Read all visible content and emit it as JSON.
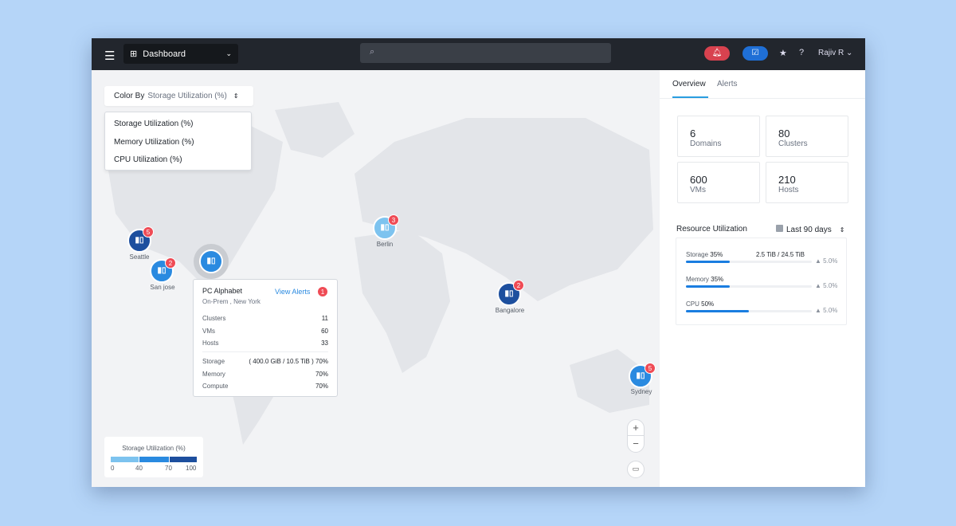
{
  "header": {
    "menu_icon": "hamburger-icon",
    "dashboard": "Dashboard",
    "search_placeholder": "",
    "user": "Rajiv R",
    "colors": {
      "alert": "#d8424f",
      "tasks": "#1f6fd6"
    }
  },
  "map": {
    "color_by_label": "Color By",
    "color_by_value": "Storage Utilization (%)",
    "options": [
      "Storage Utilization (%)",
      "Memory Utilization (%)",
      "CPU Utilization (%)"
    ],
    "markers": [
      {
        "name": "Seattle",
        "alerts": "5",
        "color": "#1d4f9e"
      },
      {
        "name": "San jose",
        "alerts": "2",
        "color": "#2a8ae0"
      },
      {
        "name": "Berlin",
        "alerts": "3",
        "color": "#7dc3ef"
      },
      {
        "name": "Bangalore",
        "alerts": "2",
        "color": "#1d4f9e"
      },
      {
        "name": "Sydney",
        "alerts": "5",
        "color": "#2a8ae0"
      }
    ],
    "tooltip": {
      "title": "PC Alphabet",
      "view_alerts": "View Alerts",
      "alerts": "1",
      "subtitle": "On-Prem , New York",
      "rows1": [
        {
          "k": "Clusters",
          "v": "11"
        },
        {
          "k": "VMs",
          "v": "60"
        },
        {
          "k": "Hosts",
          "v": "33"
        }
      ],
      "rows2": [
        {
          "k": "Storage",
          "v": "( 400.0 GiB / 10.5 TiB ) 70%"
        },
        {
          "k": "Memory",
          "v": "70%"
        },
        {
          "k": "Compute",
          "v": "70%"
        }
      ]
    },
    "legend": {
      "title": "Storage Utilization (%)",
      "ticks": [
        "0",
        "40",
        "70",
        "100"
      ],
      "colors": [
        "#7dc3ef",
        "#2a8ae0",
        "#1d4f9e"
      ]
    },
    "zoom_in": "+",
    "zoom_out": "−"
  },
  "panel": {
    "tabs": [
      "Overview",
      "Alerts"
    ],
    "stats": [
      {
        "n": "6",
        "l": "Domains"
      },
      {
        "n": "80",
        "l": "Clusters"
      },
      {
        "n": "600",
        "l": "VMs"
      },
      {
        "n": "210",
        "l": "Hosts"
      }
    ],
    "resource_title": "Resource Utilization",
    "range": "Last 90 days",
    "util": [
      {
        "label": "Storage",
        "pct": "35%",
        "value": 35,
        "detail": "2.5 TiB / 24.5 TiB",
        "change": "5.0%"
      },
      {
        "label": "Memory",
        "pct": "35%",
        "value": 35,
        "detail": "",
        "change": "5.0%"
      },
      {
        "label": "CPU",
        "pct": "50%",
        "value": 50,
        "detail": "",
        "change": "5.0%"
      }
    ]
  }
}
